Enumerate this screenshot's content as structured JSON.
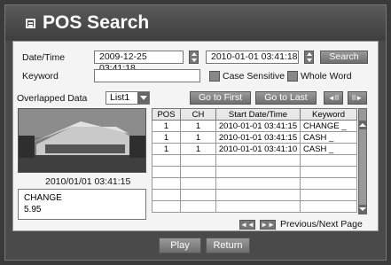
{
  "window": {
    "title": "POS Search"
  },
  "search": {
    "datetime_label": "Date/Time",
    "start": "2009-12-25  03:41:18",
    "end": "2010-01-01  03:41:18",
    "search_label": "Search",
    "keyword_label": "Keyword",
    "keyword_value": "",
    "case_sensitive_label": "Case Sensitive",
    "whole_word_label": "Whole Word"
  },
  "overlap": {
    "label": "Overlapped Data",
    "selected": "List1",
    "go_first_label": "Go to First",
    "go_last_label": "Go to Last"
  },
  "preview": {
    "timestamp": "2010/01/01  03:41:15",
    "info_line1": "CHANGE",
    "info_line2": "5.95"
  },
  "table": {
    "headers": [
      "POS",
      "CH",
      "Start Date/Time",
      "Keyword"
    ],
    "rows": [
      [
        "1",
        "1",
        "2010-01-01 03:41:15",
        "CHANGE _"
      ],
      [
        "1",
        "1",
        "2010-01-01 03:41:15",
        "CASH _"
      ],
      [
        "1",
        "1",
        "2010-01-01 03:41:10",
        "CASH _"
      ]
    ]
  },
  "pager": {
    "label": "Previous/Next Page",
    "prev_glyph": "◄◄",
    "next_glyph": "►►"
  },
  "frame_glyphs": {
    "prev": "◄II",
    "next": "II►"
  },
  "footer": {
    "play_label": "Play",
    "return_label": "Return"
  }
}
